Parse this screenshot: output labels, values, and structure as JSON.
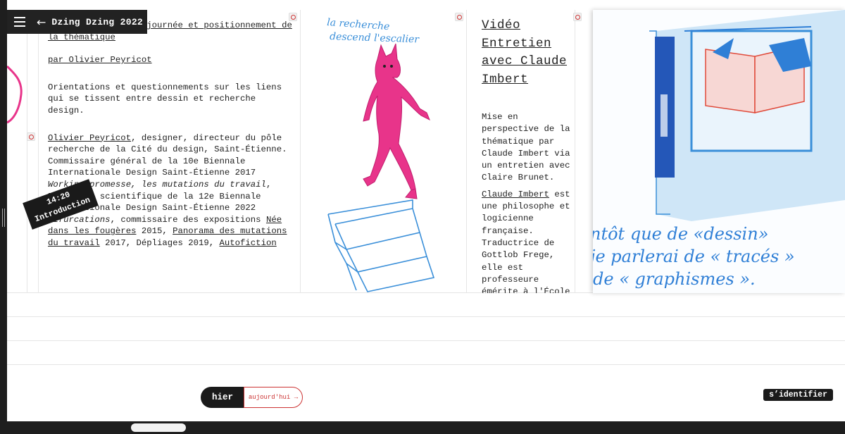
{
  "header": {
    "menu_icon": "hamburger-icon",
    "back_icon": "arrow-left-icon",
    "back_arrow": "←",
    "title": "Dzing Dzing 2022"
  },
  "text_card": {
    "title": "Présentation de la journée et positionnement de la thématique",
    "byline": "par Olivier Peyricot",
    "intro": "Orientations et questionnements sur les liens qui se tissent entre dessin et recherche design.",
    "bio_name": "Olivier Peyricot",
    "bio_1": ", designer, directeur du pôle recherche de la Cité du design, Saint-Étienne. Commissaire général de la 10e Biennale Internationale Design Saint-Étienne 2017 ",
    "bio_work_1": "Working promesse, les mutations du travail",
    "bio_2": ", Directeur scientifique de la 12e Biennale Internationale Design Saint-Étienne 2022 ",
    "bio_work_2": "Bifurcations",
    "bio_3": ", commissaire des expositions ",
    "bio_link_1": "Née dans les fougères",
    "bio_4": " 2015, ",
    "bio_link_2": "Panorama des mutations du travail",
    "bio_5": " 2017, Dépliages 2019, ",
    "bio_link_3": "Autofiction"
  },
  "drawing_card": {
    "caption_line_1": "la recherche",
    "caption_line_2": "descend l'escalier"
  },
  "video_card": {
    "title_lines": [
      "Vidéo",
      "Entretien",
      "avec Claude",
      "Imbert"
    ],
    "desc": "Mise en perspective de la thématique par Claude Imbert via un entretien avec Claire Brunet.",
    "person": "Claude Imbert",
    "person_desc": " est une philosophe et logicienne française. Traductrice de Gottlob Frege, elle est professeure émérite à l'École normale supérieure."
  },
  "big_drawing": {
    "line_1": "ntôt que de «dessin»",
    "line_2": "je parlerai de « tracés »",
    "line_3": "de « graphismes »."
  },
  "time_tag": {
    "time": "14:20",
    "label": "Introduction"
  },
  "day_toggle": {
    "yesterday": "hier",
    "today": "aujourd'hui →"
  },
  "login": "s’identifier",
  "colors": {
    "dark": "#1a1a1a",
    "accent_red": "#cc3333",
    "blue_ink": "#3a8fd9",
    "pink_ink": "#e8348a"
  }
}
